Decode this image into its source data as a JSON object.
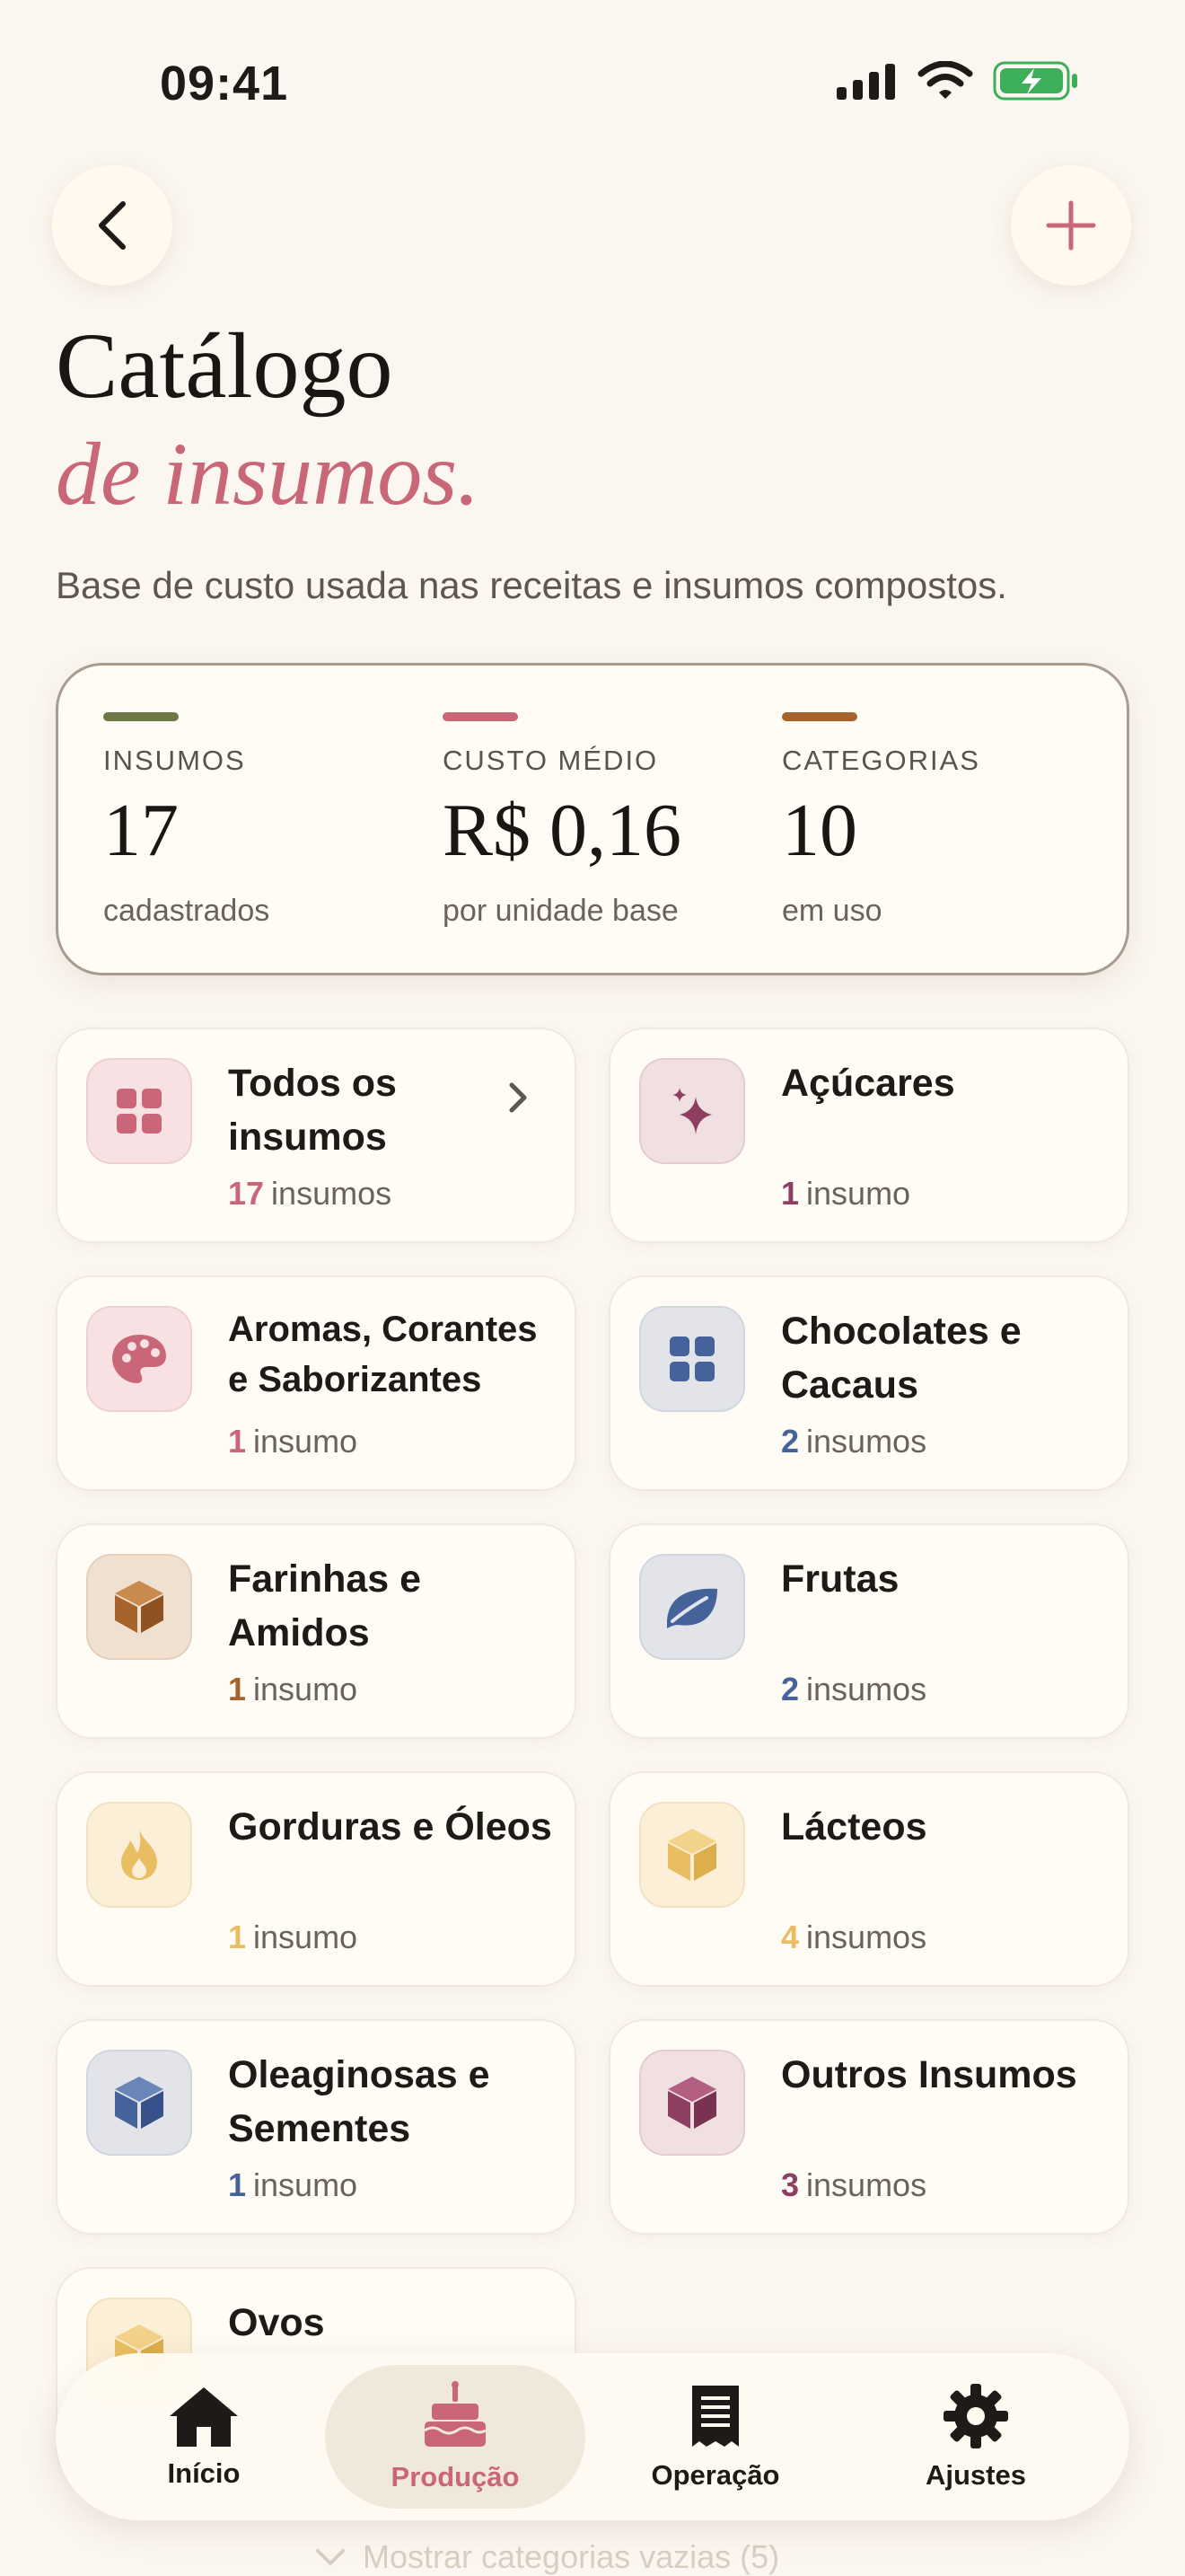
{
  "status": {
    "time": "09:41"
  },
  "header": {
    "title_line1": "Catálogo",
    "title_line2": "de insumos.",
    "subtitle": "Base de custo usada nas receitas e insumos compostos."
  },
  "summary": [
    {
      "label": "INSUMOS",
      "value": "17",
      "caption": "cadastrados",
      "color": "#6E7845"
    },
    {
      "label": "CUSTO MÉDIO",
      "value": "R$ 0,16",
      "caption": "por unidade base",
      "color": "#C96677"
    },
    {
      "label": "CATEGORIAS",
      "value": "10",
      "caption": "em uso",
      "color": "#A6642C"
    }
  ],
  "categories": [
    {
      "name": "Todos os insumos",
      "num": "17",
      "unit": "insumos",
      "icon": "grid-icon",
      "color": "#C96677",
      "bg": "#F7E1E2"
    },
    {
      "name": "Açúcares",
      "num": "1",
      "unit": "insumo",
      "icon": "sparkle-icon",
      "color": "#8E3E60",
      "bg": "#F1E0E2"
    },
    {
      "name": "Aromas, Corantes e Saborizantes",
      "num": "1",
      "unit": "insumo",
      "icon": "palette-icon",
      "color": "#C96677",
      "bg": "#F7E1E2"
    },
    {
      "name": "Chocolates e Cacaus",
      "num": "2",
      "unit": "insumos",
      "icon": "grid-icon",
      "color": "#45639A",
      "bg": "#E2E4EA"
    },
    {
      "name": "Farinhas e Amidos",
      "num": "1",
      "unit": "insumo",
      "icon": "box-icon",
      "color": "#A6642C",
      "bg": "#F0E0D0"
    },
    {
      "name": "Frutas",
      "num": "2",
      "unit": "insumos",
      "icon": "leaf-icon",
      "color": "#45639A",
      "bg": "#E2E4EA"
    },
    {
      "name": "Gorduras e Óleos",
      "num": "1",
      "unit": "insumo",
      "icon": "flame-icon",
      "color": "#E9BE63",
      "bg": "#FBEFD8"
    },
    {
      "name": "Lácteos",
      "num": "4",
      "unit": "insumos",
      "icon": "box-icon",
      "color": "#E9BE63",
      "bg": "#FBEFD8"
    },
    {
      "name": "Oleaginosas e Sementes",
      "num": "1",
      "unit": "insumo",
      "icon": "box-icon",
      "color": "#45639A",
      "bg": "#E2E4EA"
    },
    {
      "name": "Outros Insumos",
      "num": "3",
      "unit": "insumos",
      "icon": "box-icon",
      "color": "#8E3E60",
      "bg": "#F1E0E2"
    },
    {
      "name": "Ovos",
      "num": "",
      "unit": "",
      "icon": "box-icon",
      "color": "#E9BE63",
      "bg": "#FBEFD8"
    }
  ],
  "tabs": [
    {
      "label": "Início",
      "icon": "home-icon"
    },
    {
      "label": "Produção",
      "icon": "cake-icon",
      "active": true
    },
    {
      "label": "Operação",
      "icon": "receipt-icon"
    },
    {
      "label": "Ajustes",
      "icon": "gear-icon"
    }
  ],
  "empty_toggle": "Mostrar categorias vazias (5)"
}
